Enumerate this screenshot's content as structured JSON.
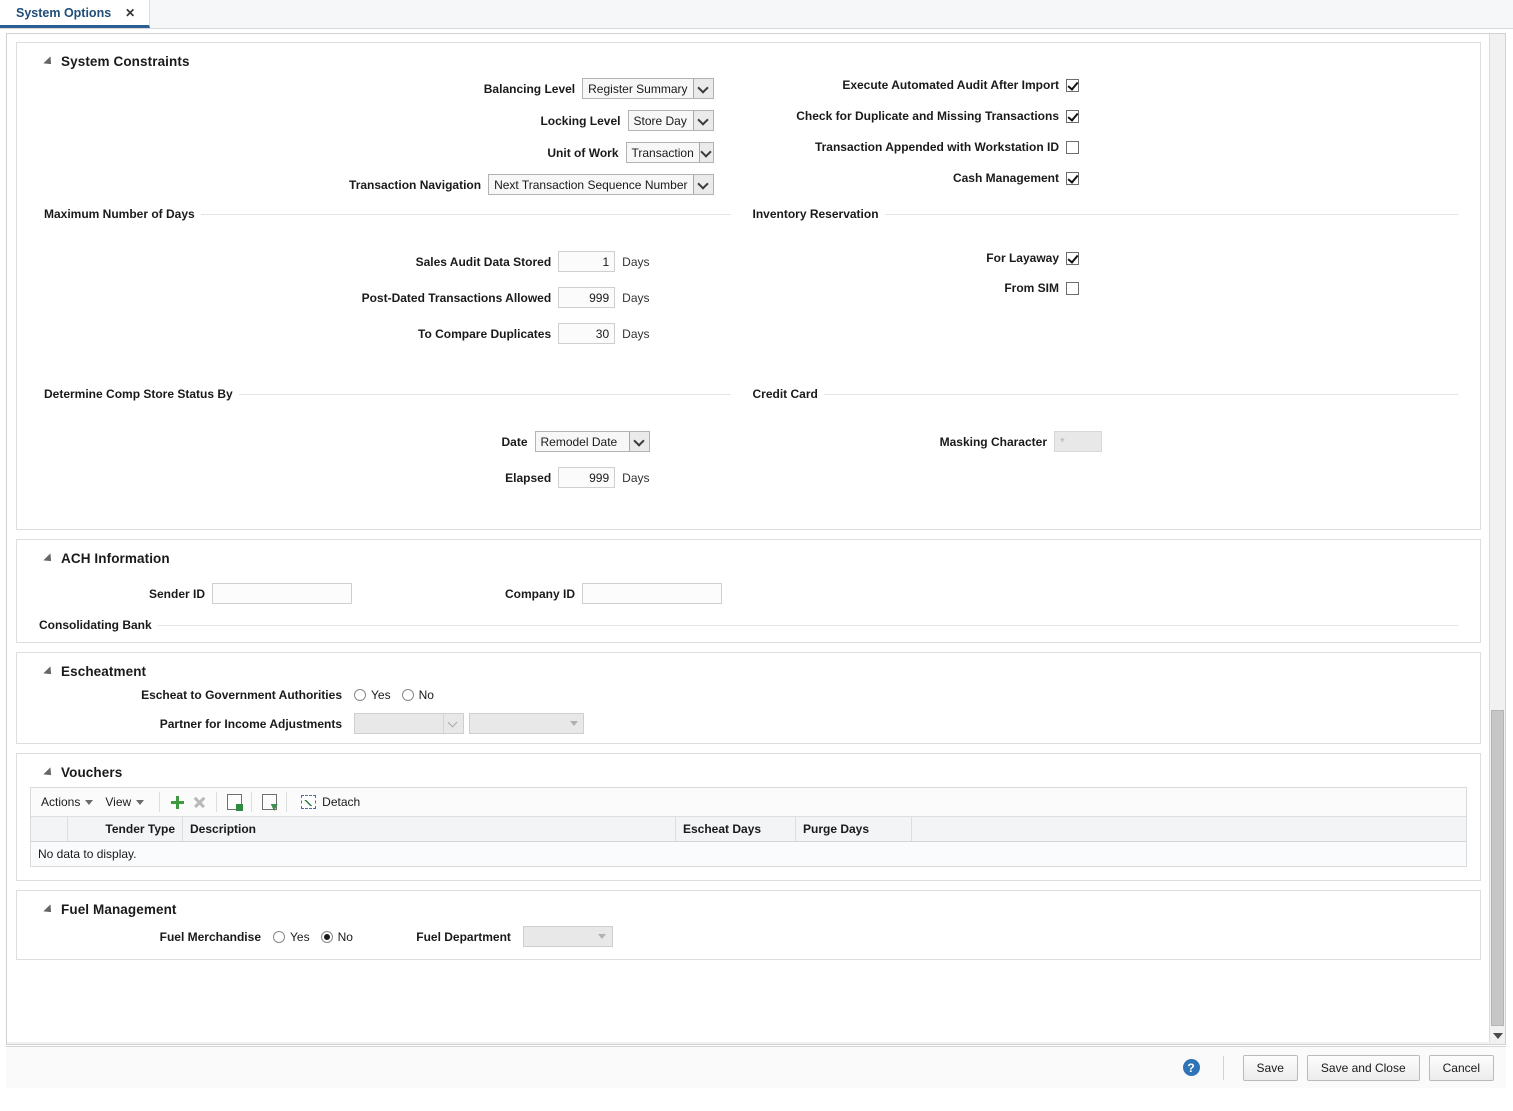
{
  "tab": {
    "label": "System Options",
    "close": "✕"
  },
  "sections": {
    "system_constraints": {
      "title": "System Constraints",
      "fields": {
        "balancing_level": {
          "label": "Balancing Level",
          "value": "Register Summary"
        },
        "locking_level": {
          "label": "Locking Level",
          "value": "Store Day"
        },
        "unit_of_work": {
          "label": "Unit of Work",
          "value": "Transaction"
        },
        "transaction_navigation": {
          "label": "Transaction Navigation",
          "value": "Next Transaction Sequence Number"
        }
      },
      "checkboxes": {
        "execute_audit": {
          "label": "Execute Automated Audit After Import",
          "checked": true
        },
        "check_duplicate": {
          "label": "Check for Duplicate and Missing Transactions",
          "checked": true
        },
        "workstation_id": {
          "label": "Transaction Appended with Workstation ID",
          "checked": false
        },
        "cash_management": {
          "label": "Cash Management",
          "checked": true
        }
      },
      "max_days": {
        "group_title": "Maximum Number of Days",
        "unit": "Days",
        "rows": [
          {
            "label": "Sales Audit Data Stored",
            "value": "1"
          },
          {
            "label": "Post-Dated Transactions Allowed",
            "value": "999"
          },
          {
            "label": "To Compare Duplicates",
            "value": "30"
          }
        ]
      },
      "inventory_reservation": {
        "group_title": "Inventory Reservation",
        "checkboxes": [
          {
            "label": "For Layaway",
            "checked": true
          },
          {
            "label": "From SIM",
            "checked": false
          }
        ]
      },
      "comp_store": {
        "group_title": "Determine Comp Store Status By",
        "date": {
          "label": "Date",
          "value": "Remodel Date"
        },
        "elapsed": {
          "label": "Elapsed",
          "value": "999",
          "unit": "Days"
        }
      },
      "credit_card": {
        "group_title": "Credit Card",
        "masking_character": {
          "label": "Masking Character",
          "value": "*",
          "disabled": true
        }
      }
    },
    "ach_information": {
      "title": "ACH Information",
      "sender_id": {
        "label": "Sender ID",
        "value": "",
        "placeholder": ""
      },
      "company_id": {
        "label": "Company ID",
        "value": "",
        "placeholder": ""
      },
      "consolidating_bank": {
        "group_title": "Consolidating Bank"
      }
    },
    "escheatment": {
      "title": "Escheatment",
      "escheat_to_gov": {
        "label": "Escheat to Government Authorities",
        "options": [
          {
            "label": "Yes",
            "selected": false
          },
          {
            "label": "No",
            "selected": false
          }
        ]
      },
      "partner_income_adjustments": {
        "label": "Partner for Income Adjustments",
        "value": "",
        "disabled": true,
        "lov_disabled": true
      }
    },
    "vouchers": {
      "title": "Vouchers",
      "toolbar": {
        "actions": "Actions",
        "view": "View",
        "add": "add-row",
        "delete": "delete-row",
        "export": "export-to-excel",
        "query": "query-by-example",
        "detach": "Detach"
      },
      "columns": [
        "",
        "Tender Type",
        "Description",
        "Escheat Days",
        "Purge Days"
      ],
      "rows": [],
      "empty_message": "No data to display."
    },
    "fuel_management": {
      "title": "Fuel Management",
      "fuel_merchandise": {
        "label": "Fuel Merchandise",
        "options": [
          {
            "label": "Yes",
            "selected": false
          },
          {
            "label": "No",
            "selected": true
          }
        ]
      },
      "fuel_department": {
        "label": "Fuel Department",
        "value": "",
        "disabled": true
      }
    }
  },
  "footer": {
    "help": "?",
    "save": "Save",
    "save_and_close": "Save and Close",
    "cancel": "Cancel"
  },
  "colors": {
    "tab_accent": "#2a5f94",
    "tab_text": "#1f4e79",
    "help_blue": "#2f74b5",
    "add_green": "#3f9a3f"
  }
}
